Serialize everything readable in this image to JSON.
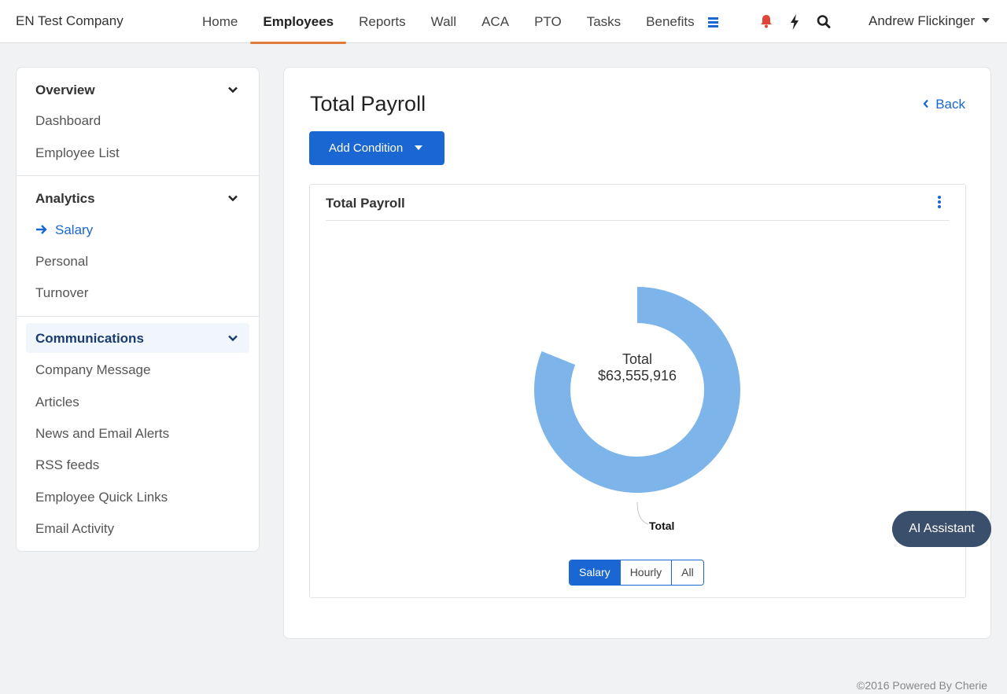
{
  "header": {
    "brand": "EN Test Company",
    "nav": [
      {
        "label": "Home",
        "active": false
      },
      {
        "label": "Employees",
        "active": true
      },
      {
        "label": "Reports",
        "active": false
      },
      {
        "label": "Wall",
        "active": false
      },
      {
        "label": "ACA",
        "active": false
      },
      {
        "label": "PTO",
        "active": false
      },
      {
        "label": "Tasks",
        "active": false
      },
      {
        "label": "Benefits",
        "active": false
      }
    ],
    "icons": [
      "menu-icon",
      "bell-icon",
      "bolt-icon",
      "search-icon"
    ],
    "user_name": "Andrew Flickinger"
  },
  "sidebar": {
    "sections": [
      {
        "title": "Overview",
        "items": [
          "Dashboard",
          "Employee List"
        ]
      },
      {
        "title": "Analytics",
        "items": [
          "Salary",
          "Personal",
          "Turnover"
        ],
        "active_item": "Salary"
      },
      {
        "title": "Communications",
        "items": [
          "Company Message",
          "Articles",
          "News and Email Alerts",
          "RSS feeds",
          "Employee Quick Links",
          "Email Activity"
        ]
      }
    ]
  },
  "main": {
    "title": "Total Payroll",
    "back_label": "Back",
    "add_condition_label": "Add Condition",
    "card": {
      "title": "Total Payroll",
      "toggle": [
        {
          "label": "Salary",
          "active": true
        },
        {
          "label": "Hourly",
          "active": false
        },
        {
          "label": "All",
          "active": false
        }
      ]
    }
  },
  "chart_data": {
    "type": "pie",
    "donut": true,
    "center_label": "Total",
    "center_value": "$63,555,916",
    "slices": [
      {
        "name": "Total",
        "value": 63555916,
        "color": "#7db4ea"
      }
    ]
  },
  "ai_assistant_label": "AI Assistant",
  "footer": "©2016 Powered By Cherie",
  "colors": {
    "accent": "#1a66d2",
    "active_tab_underline": "#e07b39",
    "donut": "#7db4ea",
    "bell": "#e0453a"
  }
}
